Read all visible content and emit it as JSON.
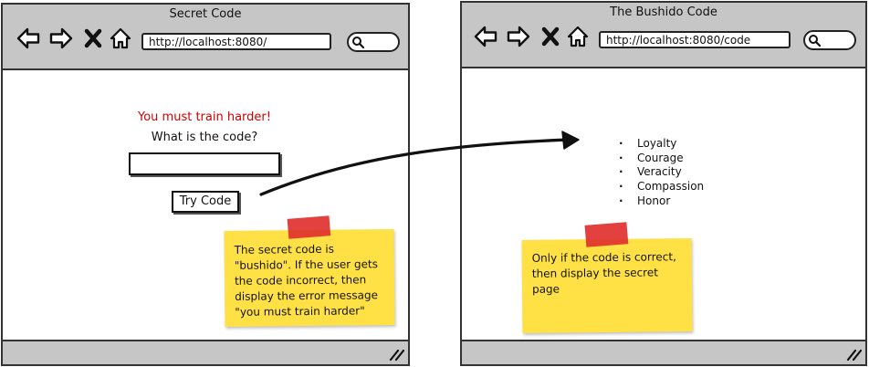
{
  "left_window": {
    "title": "Secret Code",
    "url": "http://localhost:8080/",
    "error_message": "You must train harder!",
    "question": "What is the code?",
    "code_input_value": "",
    "try_button_label": "Try Code"
  },
  "right_window": {
    "title": "The Bushido Code",
    "url": "http://localhost:8080/code",
    "virtues": [
      "Loyalty",
      "Courage",
      "Veracity",
      "Compassion",
      "Honor"
    ]
  },
  "notes": {
    "left": "The secret code is \"bushido\". If the user gets the code incorrect, then display the error message \"you must train harder\"",
    "right": "Only if the code is correct, then display the secret page"
  },
  "colors": {
    "chrome": "#c6c6c6",
    "error_text": "#d10000",
    "sticky": "#ffe146",
    "tape": "#e0312f"
  },
  "icons": [
    "back-arrow-icon",
    "forward-arrow-icon",
    "close-x-icon",
    "home-icon",
    "search-icon",
    "resize-grip-icon"
  ]
}
